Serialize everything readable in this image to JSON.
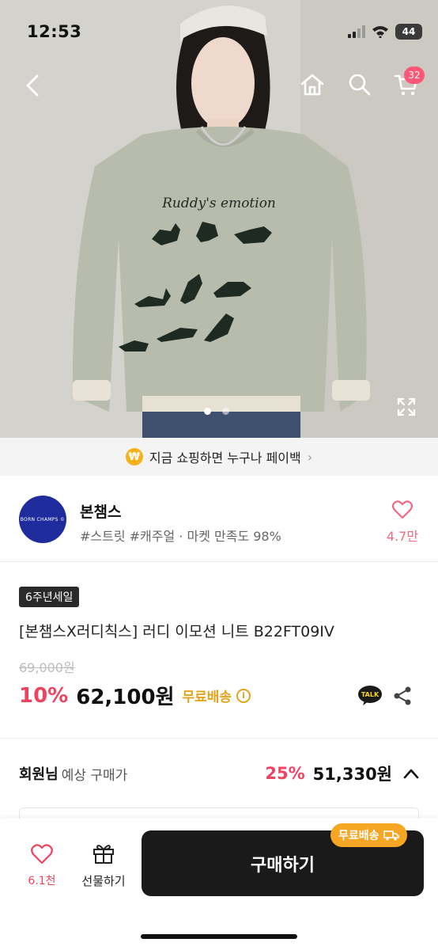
{
  "status_bar": {
    "time": "12:53",
    "battery": "44"
  },
  "nav": {
    "cart_count": "32"
  },
  "hero": {
    "shirt_text": "Ruddy's emotion",
    "current_slide": 1,
    "total_slides": 2
  },
  "payback": {
    "coin": "₩",
    "text": "지금 쇼핑하면 누구나 페이백"
  },
  "store": {
    "logo_text": "BORN CHAMPS ©",
    "name": "본챔스",
    "tags": "#스트릿 #캐주얼 · 마켓 만족도 98%",
    "likes": "4.7만"
  },
  "product": {
    "badge": "6주년세일",
    "title": "[본챔스X러디칙스] 러디 이모션 니트 B22FT09IV",
    "original_price": "69,000원",
    "discount": "10%",
    "price": "62,100원",
    "shipping": "무료배송",
    "talk_label": "TALK"
  },
  "member": {
    "label": "회원님",
    "sub": "예상 구매가",
    "discount": "25%",
    "price": "51,330원"
  },
  "bottom": {
    "wish_count": "6.1천",
    "gift_label": "선물하기",
    "buy_label": "구매하기",
    "ship_tag": "무료배송"
  },
  "colors": {
    "accent": "#f0435f",
    "shipping": "#e3a41b",
    "buy": "#1a1a1a"
  }
}
